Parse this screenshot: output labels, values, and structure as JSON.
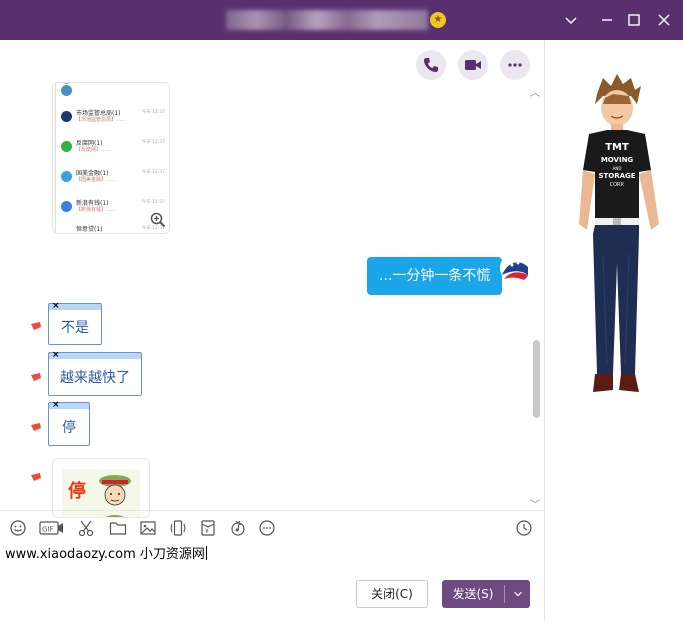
{
  "titlebar": {
    "title_blurred": true,
    "badge_icon": "star-badge-icon",
    "controls": [
      "chevron-down-icon",
      "minimize-icon",
      "maximize-icon",
      "close-icon"
    ],
    "bg_color": "#5a2f6e"
  },
  "header_actions": [
    "phone-icon",
    "video-icon",
    "more-icon"
  ],
  "screenshot": {
    "rows": [
      {
        "title": "市场监管总局(1)",
        "sub": "【市场监管总局】……",
        "time": "今天 12:37"
      },
      {
        "title": "反腐网(1)",
        "sub": "【反腐网】……",
        "time": "今天 12:37"
      },
      {
        "title": "国美金融(1)",
        "sub": "【国美金融】……",
        "time": "今天 12:37"
      },
      {
        "title": "新浪有钱(1)",
        "sub": "【新浪有钱】……",
        "time": "今天 12:37"
      },
      {
        "title": "恒意贷(1)",
        "sub": "",
        "time": "今天 12:37"
      }
    ]
  },
  "messages": {
    "my_message": "...一分钟一条不慌",
    "stickers": [
      "不是",
      "越来越快了",
      "停"
    ],
    "gif_text": "停"
  },
  "toolbar": [
    "emoji-icon",
    "gif-icon",
    "scissors-icon",
    "folder-icon",
    "image-icon",
    "shake-icon",
    "red-packet-icon",
    "music-icon",
    "more-icon",
    "history-icon"
  ],
  "input": {
    "value": "www.xiaodaozy.com 小刀资源网"
  },
  "buttons": {
    "close_label": "关闭(C)",
    "send_label": "发送(S)"
  },
  "colors": {
    "accent": "#6e4a80",
    "bubble": "#1aa6e8",
    "sticker_border": "#6c8fd8"
  },
  "avatar_shirt": {
    "line1": "TMT",
    "line2": "MOVING",
    "line3": "AND",
    "line4": "STORAGE",
    "line5": "CORP."
  }
}
